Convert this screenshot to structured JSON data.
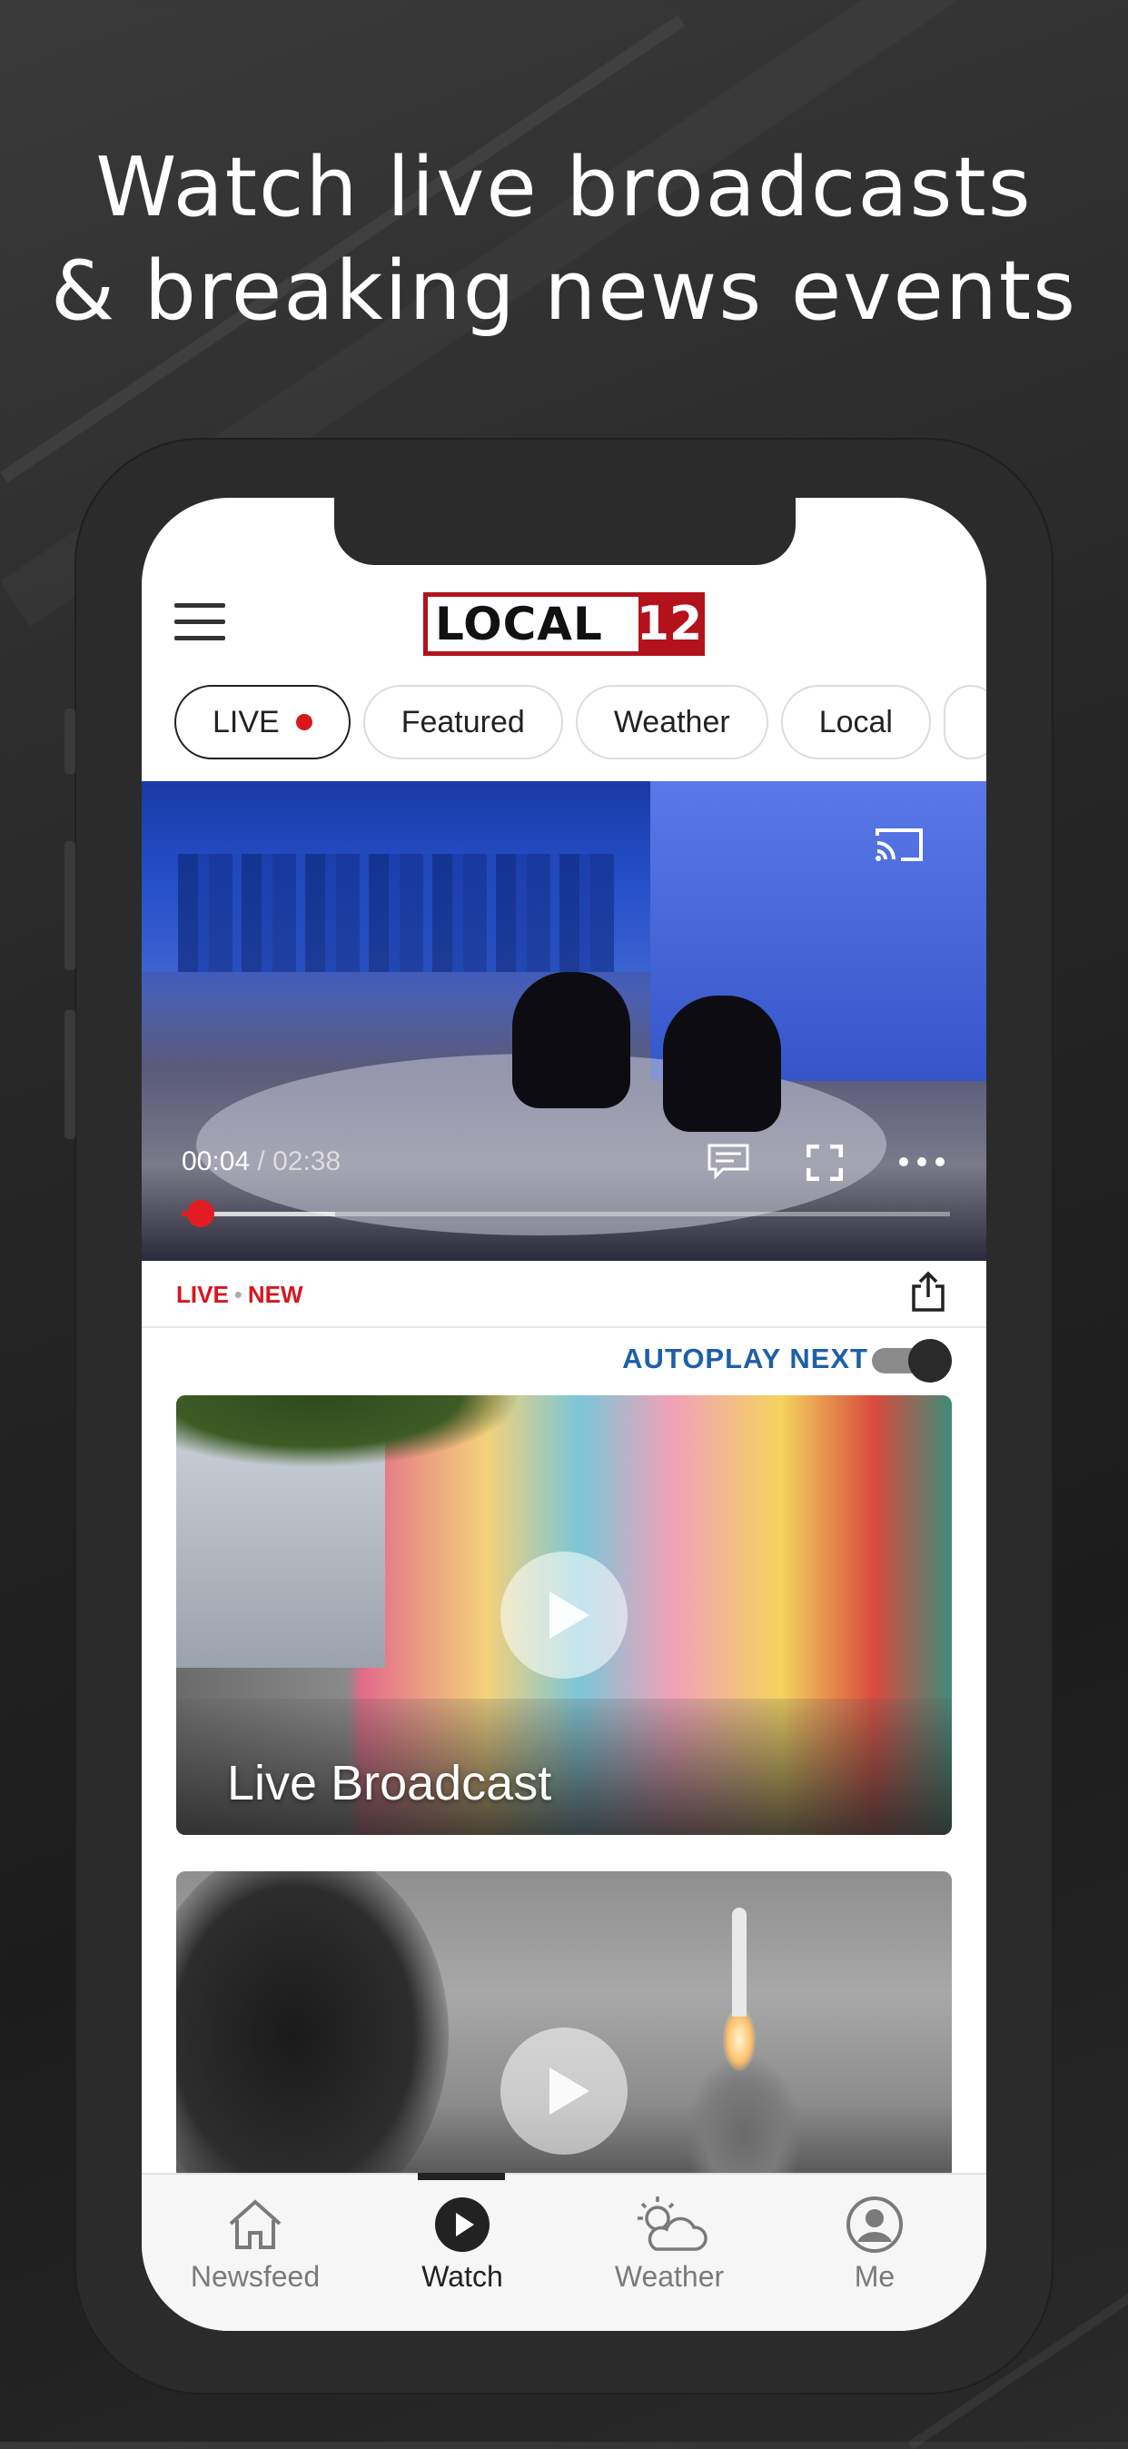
{
  "headline": {
    "line1": "Watch live broadcasts",
    "line2": "& breaking news events"
  },
  "header": {
    "logo_text": "LOCAL",
    "logo_number": "12",
    "brand_color": "#b3121b"
  },
  "chips": [
    {
      "label": "LIVE",
      "live_dot": true
    },
    {
      "label": "Featured"
    },
    {
      "label": "Weather"
    },
    {
      "label": "Local"
    }
  ],
  "player": {
    "current_time": "00:04",
    "separator": " / ",
    "duration": "02:38",
    "progress_fraction": 0.025,
    "buffered_fraction": 0.2
  },
  "meta": {
    "tag_live": "LIVE",
    "tag_sep": "•",
    "tag_new": "NEW",
    "tag_color": "#d7161e"
  },
  "autoplay": {
    "label": "AUTOPLAY NEXT",
    "enabled": true,
    "color": "#1e5fa8"
  },
  "cards": [
    {
      "title": "Live Broadcast"
    },
    {
      "title": ""
    }
  ],
  "tabbar": {
    "items": [
      {
        "label": "Newsfeed",
        "icon": "house-icon"
      },
      {
        "label": "Watch",
        "icon": "play-circle-icon",
        "active": true
      },
      {
        "label": "Weather",
        "icon": "partly-cloudy-icon"
      },
      {
        "label": "Me",
        "icon": "user-circle-icon"
      }
    ]
  }
}
